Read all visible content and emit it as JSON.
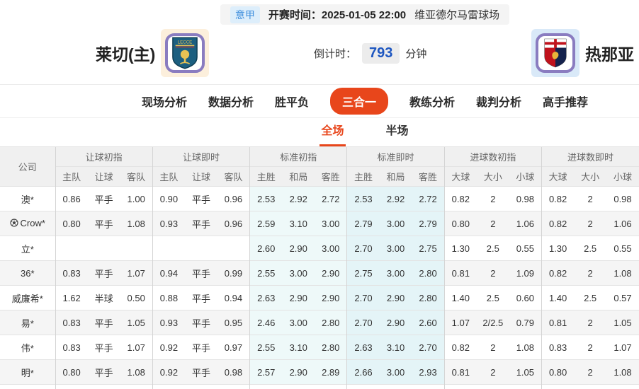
{
  "header": {
    "league": "意甲",
    "kickoff": "开赛时间：2025-01-05 22:00",
    "venue": "维亚德尔马雷球场",
    "home_team": "莱切(主)",
    "away_team": "热那亚",
    "countdown_label": "倒计时：",
    "countdown_value": "793",
    "countdown_unit": "分钟"
  },
  "nav": {
    "items": [
      {
        "label": "现场分析",
        "active": false
      },
      {
        "label": "数据分析",
        "active": false
      },
      {
        "label": "胜平负",
        "active": false
      },
      {
        "label": "三合一",
        "active": true
      },
      {
        "label": "教练分析",
        "active": false
      },
      {
        "label": "裁判分析",
        "active": false
      },
      {
        "label": "高手推荐",
        "active": false
      }
    ]
  },
  "subtabs": [
    {
      "label": "全场",
      "active": true
    },
    {
      "label": "半场",
      "active": false
    }
  ],
  "table": {
    "company_header": "公司",
    "groups": [
      {
        "label": "让球初指",
        "cols": [
          "主队",
          "让球",
          "客队"
        ]
      },
      {
        "label": "让球即时",
        "cols": [
          "主队",
          "让球",
          "客队"
        ]
      },
      {
        "label": "标准初指",
        "cols": [
          "主胜",
          "和局",
          "客胜"
        ]
      },
      {
        "label": "标准即时",
        "cols": [
          "主胜",
          "和局",
          "客胜"
        ]
      },
      {
        "label": "进球数初指",
        "cols": [
          "大球",
          "大小",
          "小球"
        ]
      },
      {
        "label": "进球数即时",
        "cols": [
          "大球",
          "大小",
          "小球"
        ]
      }
    ],
    "rows": [
      {
        "company": "澳*",
        "has_icon": false,
        "cells": [
          "0.86",
          "平手",
          "1.00",
          "0.90",
          "平手",
          "0.96",
          "2.53",
          "2.92",
          "2.72",
          "2.53",
          "2.92",
          "2.72",
          "0.82",
          "2",
          "0.98",
          "0.82",
          "2",
          "0.98"
        ]
      },
      {
        "company": "Crow*",
        "has_icon": true,
        "cells": [
          "0.80",
          "平手",
          "1.08",
          "0.93",
          "平手",
          "0.96",
          "2.59",
          "3.10",
          "3.00",
          "2.79",
          "3.00",
          "2.79",
          "0.80",
          "2",
          "1.06",
          "0.82",
          "2",
          "1.06"
        ]
      },
      {
        "company": "立*",
        "has_icon": false,
        "cells": [
          "",
          "",
          "",
          "",
          "",
          "",
          "2.60",
          "2.90",
          "3.00",
          "2.70",
          "3.00",
          "2.75",
          "1.30",
          "2.5",
          "0.55",
          "1.30",
          "2.5",
          "0.55"
        ]
      },
      {
        "company": "36*",
        "has_icon": false,
        "cells": [
          "0.83",
          "平手",
          "1.07",
          "0.94",
          "平手",
          "0.99",
          "2.55",
          "3.00",
          "2.90",
          "2.75",
          "3.00",
          "2.80",
          "0.81",
          "2",
          "1.09",
          "0.82",
          "2",
          "1.08"
        ]
      },
      {
        "company": "威廉希*",
        "has_icon": false,
        "cells": [
          "1.62",
          "半球",
          "0.50",
          "0.88",
          "平手",
          "0.94",
          "2.63",
          "2.90",
          "2.90",
          "2.70",
          "2.90",
          "2.80",
          "1.40",
          "2.5",
          "0.60",
          "1.40",
          "2.5",
          "0.57"
        ]
      },
      {
        "company": "易*",
        "has_icon": false,
        "cells": [
          "0.83",
          "平手",
          "1.05",
          "0.93",
          "平手",
          "0.95",
          "2.46",
          "3.00",
          "2.80",
          "2.70",
          "2.90",
          "2.60",
          "1.07",
          "2/2.5",
          "0.79",
          "0.81",
          "2",
          "1.05"
        ]
      },
      {
        "company": "伟*",
        "has_icon": false,
        "cells": [
          "0.83",
          "平手",
          "1.07",
          "0.92",
          "平手",
          "0.97",
          "2.55",
          "3.10",
          "2.80",
          "2.63",
          "3.10",
          "2.70",
          "0.82",
          "2",
          "1.08",
          "0.83",
          "2",
          "1.07"
        ]
      },
      {
        "company": "明*",
        "has_icon": false,
        "cells": [
          "0.80",
          "平手",
          "1.08",
          "0.92",
          "平手",
          "0.98",
          "2.57",
          "2.90",
          "2.89",
          "2.66",
          "3.00",
          "2.93",
          "0.81",
          "2",
          "1.05",
          "0.80",
          "2",
          "1.08"
        ]
      }
    ]
  },
  "colors": {
    "accent_orange": "#e8461b",
    "live_blue": "#2b62c4",
    "league_blue": "#3f8fdd",
    "std_init_bg": "#eef9f9",
    "std_live_bg": "#e4f4f7",
    "stripe_bg": "#f5f5f5",
    "tile_purple_border": "#8a7cc0",
    "home_tile_bg": "#fcefdc",
    "away_tile_bg": "#d9e9f8"
  }
}
